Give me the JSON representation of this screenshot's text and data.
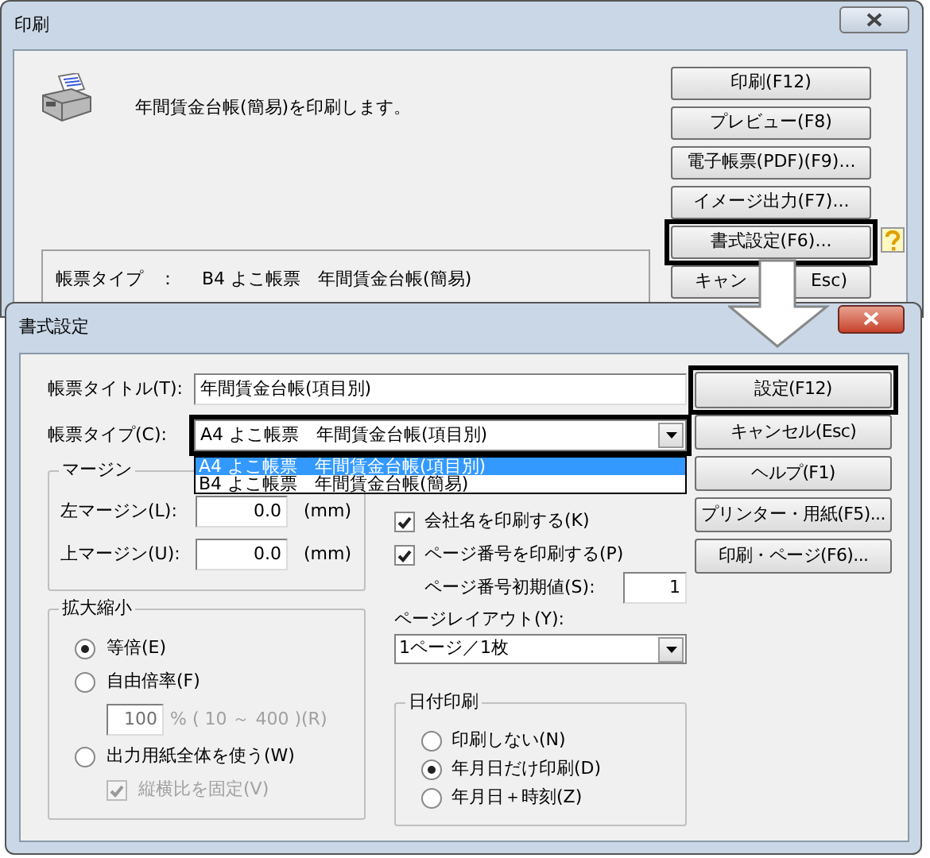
{
  "print_window": {
    "title": "印刷",
    "message": "年間賃金台帳(簡易)を印刷します。",
    "form_type_label": "帳票タイプ",
    "form_type_separator": "：",
    "form_type_value": "B4 よこ帳票　年間賃金台帳(簡易)",
    "buttons": [
      {
        "label": "印刷(F12)",
        "highlighted": false
      },
      {
        "label": "プレビュー(F8)",
        "highlighted": false
      },
      {
        "label": "電子帳票(PDF)(F9)...",
        "highlighted": false
      },
      {
        "label": "イメージ出力(F7)...",
        "highlighted": false
      },
      {
        "label": "書式設定(F6)...",
        "highlighted": true
      },
      {
        "label_parts": [
          "キャン",
          "Esc)"
        ],
        "highlighted": false
      }
    ]
  },
  "format_dialog": {
    "title": "書式設定",
    "title_label": "帳票タイトル(T):",
    "title_value": "年間賃金台帳(項目別)",
    "type_label": "帳票タイプ(C):",
    "type_value": "A4 よこ帳票　年間賃金台帳(項目別)",
    "type_highlighted": true,
    "type_options": [
      {
        "label": "A4 よこ帳票　年間賃金台帳(項目別)",
        "selected": true
      },
      {
        "label": "B4 よこ帳票　年間賃金台帳(簡易)",
        "selected": false
      }
    ],
    "margin": {
      "title": "マージン",
      "fields": [
        {
          "label": "左マージン(L):",
          "value": "0.0",
          "unit": "(mm)"
        },
        {
          "label": "上マージン(U):",
          "value": "0.0",
          "unit": "(mm)"
        }
      ]
    },
    "scale": {
      "title": "拡大縮小",
      "items": [
        {
          "kind": "radio",
          "label": "等倍(E)",
          "selected": true
        },
        {
          "kind": "radio",
          "label": "自由倍率(F)",
          "selected": false
        },
        {
          "kind": "percent",
          "value": "100",
          "range": "% ( 10 ～ 400 )(R)",
          "disabled": true
        },
        {
          "kind": "radio",
          "label": "出力用紙全体を使う(W)",
          "selected": false
        },
        {
          "kind": "checkbox",
          "label": "縦横比を固定(V)",
          "checked": true,
          "disabled": true
        }
      ]
    },
    "options": [
      {
        "label": "会社名を印刷する(K)",
        "checked": true
      },
      {
        "label": "ページ番号を印刷する(P)",
        "checked": true
      }
    ],
    "start_page": {
      "label": "ページ番号初期値(S):",
      "value": "1"
    },
    "layout": {
      "label": "ページレイアウト(Y):",
      "value": "1ページ／1枚"
    },
    "date_print": {
      "title": "日付印刷",
      "options": [
        {
          "label": "印刷しない(N)",
          "selected": false
        },
        {
          "label": "年月日だけ印刷(D)",
          "selected": true
        },
        {
          "label": "年月日＋時刻(Z)",
          "selected": false
        }
      ]
    },
    "buttons": [
      {
        "label": "設定(F12)",
        "highlighted": true
      },
      {
        "label": "キャンセル(Esc)",
        "highlighted": false
      },
      {
        "label": "ヘルプ(F1)",
        "highlighted": false
      },
      {
        "label": "プリンター・用紙(F5)...",
        "highlighted": false
      },
      {
        "label": "印刷・ページ(F6)...",
        "highlighted": false
      }
    ]
  }
}
